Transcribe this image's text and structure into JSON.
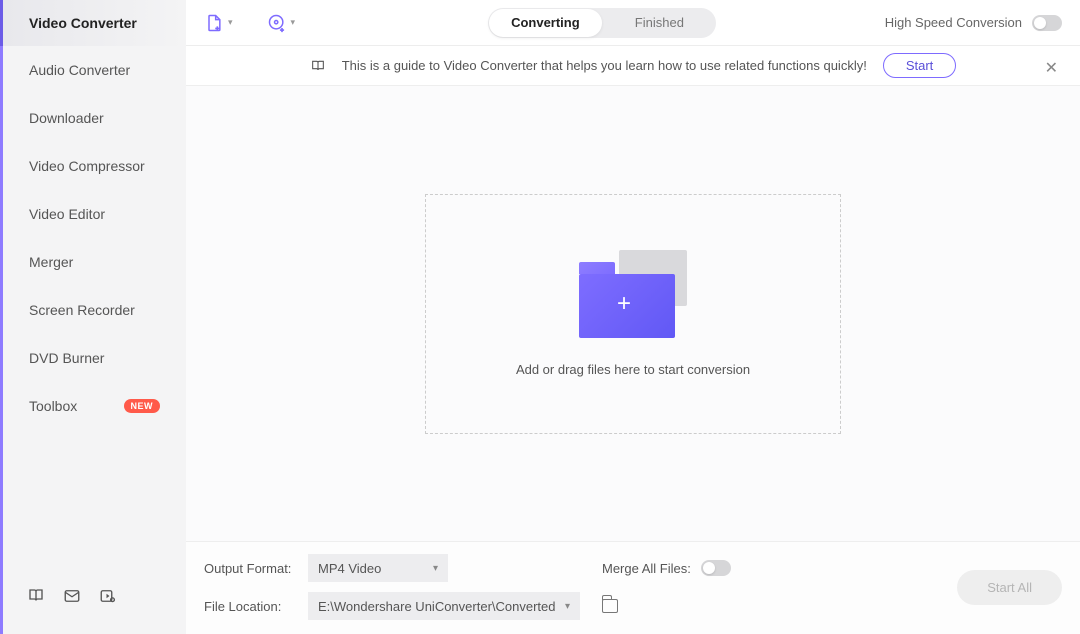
{
  "sidebar": {
    "items": [
      {
        "label": "Video Converter",
        "active": true
      },
      {
        "label": "Audio Converter"
      },
      {
        "label": "Downloader"
      },
      {
        "label": "Video Compressor"
      },
      {
        "label": "Video Editor"
      },
      {
        "label": "Merger"
      },
      {
        "label": "Screen Recorder"
      },
      {
        "label": "DVD Burner"
      },
      {
        "label": "Toolbox",
        "badge": "NEW"
      }
    ]
  },
  "toolbar": {
    "tabs": {
      "converting": "Converting",
      "finished": "Finished"
    },
    "high_speed_label": "High Speed Conversion"
  },
  "guide": {
    "text": "This is a guide to Video Converter that helps you learn how to use related functions quickly!",
    "start_label": "Start"
  },
  "dropzone": {
    "label": "Add or drag files here to start conversion"
  },
  "bottom": {
    "output_format_label": "Output Format:",
    "output_format_value": "MP4 Video",
    "merge_label": "Merge All Files:",
    "file_location_label": "File Location:",
    "file_location_value": "E:\\Wondershare UniConverter\\Converted",
    "start_all_label": "Start All"
  }
}
